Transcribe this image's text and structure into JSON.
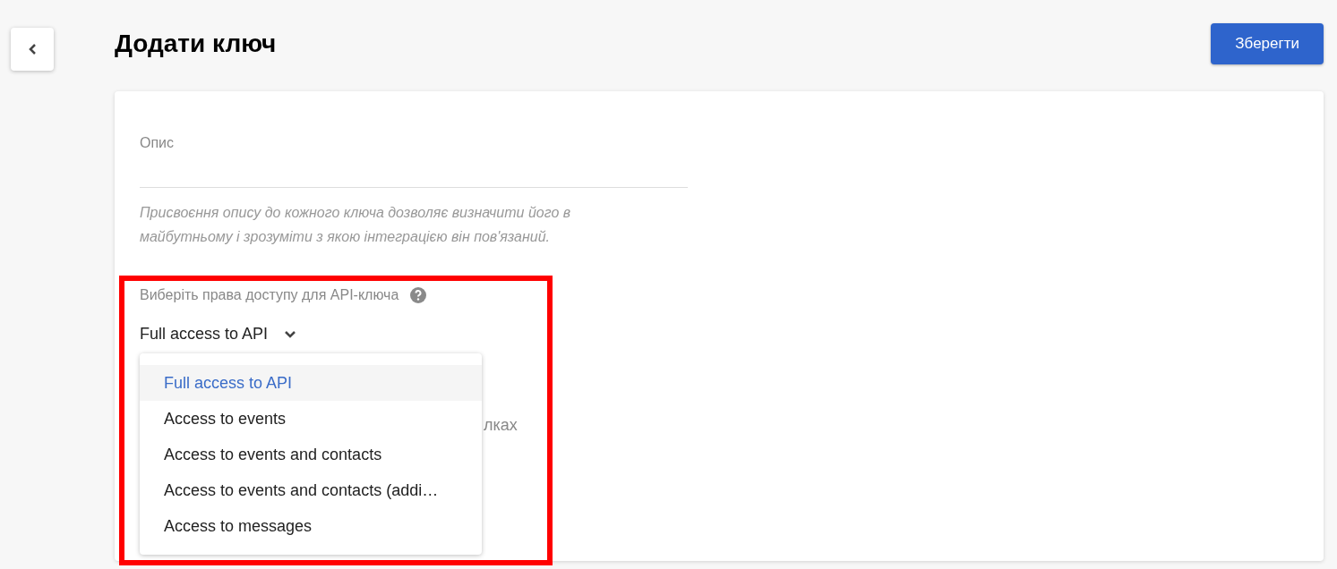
{
  "header": {
    "title": "Додати ключ",
    "save_button": "Зберегти"
  },
  "description_field": {
    "label": "Опис",
    "hint": "Присвоєння опису до кожного ключа дозволяє визначити його в майбутньому і зрозуміти з якою інтеграцією він пов'язаний."
  },
  "permissions": {
    "label": "Виберіть права доступу для API-ключа",
    "value": "Full access to API",
    "partially_hidden_text": "лках",
    "options": [
      {
        "label": "Full access to API",
        "selected": true
      },
      {
        "label": "Access to events",
        "selected": false
      },
      {
        "label": "Access to events and contacts",
        "selected": false
      },
      {
        "label": "Access to events and contacts (addi…",
        "selected": false
      },
      {
        "label": "Access to messages",
        "selected": false
      }
    ]
  }
}
